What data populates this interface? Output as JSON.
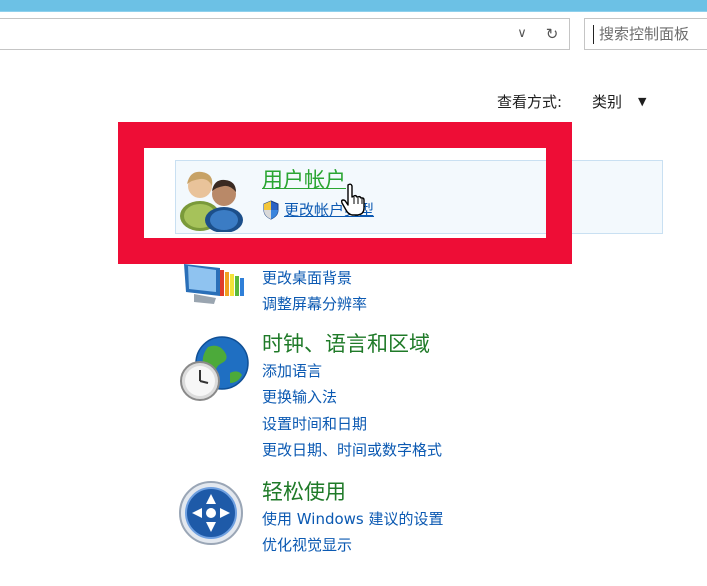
{
  "search": {
    "placeholder": "搜索控制面板"
  },
  "view_by": {
    "label": "查看方式:",
    "value": "类别"
  },
  "categories": [
    {
      "title": "用户帐户",
      "icon": "user-accounts-icon",
      "links": [
        {
          "label": "更改帐户类型",
          "icon": "uac-shield-icon"
        }
      ]
    },
    {
      "title": "",
      "icon": "appearance-monitor-icon",
      "links": [
        {
          "label": "更改桌面背景"
        },
        {
          "label": "调整屏幕分辨率"
        }
      ]
    },
    {
      "title": "时钟、语言和区域",
      "icon": "clock-globe-icon",
      "links": [
        {
          "label": "添加语言"
        },
        {
          "label": "更换输入法"
        },
        {
          "label": "设置时间和日期"
        },
        {
          "label": "更改日期、时间或数字格式"
        }
      ]
    },
    {
      "title": "轻松使用",
      "icon": "ease-of-access-icon",
      "links": [
        {
          "label": "使用 Windows 建议的设置"
        },
        {
          "label": "优化视觉显示"
        }
      ]
    }
  ],
  "colors": {
    "highlight_frame": "#ee0d36",
    "title_green": "#1f7a28",
    "link_blue": "#0b59b2",
    "titlebar": "#6cc1e5"
  }
}
